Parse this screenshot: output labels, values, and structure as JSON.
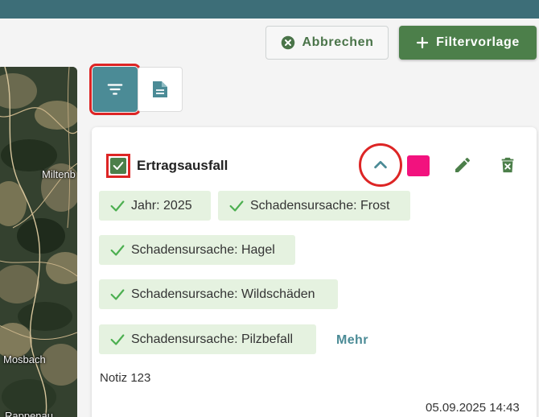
{
  "header": {
    "cancel_label": "Abbrechen",
    "new_template_label": "Filtervorlage",
    "accent": "#3d6e78"
  },
  "map": {
    "labels": [
      "Miltenb",
      "Mosbach",
      "Rappenau"
    ]
  },
  "view_toggle": {
    "icons": [
      "filter-icon",
      "document-icon"
    ],
    "active": "filter-icon"
  },
  "filter_card": {
    "title": "Ertragsausfall",
    "checked": true,
    "color": "#f2127e",
    "chips": [
      "Jahr: 2025",
      "Schadensursache: Frost",
      "Schadensursache: Hagel",
      "Schadensursache: Wildschäden",
      "Schadensursache: Pilzbefall"
    ],
    "more_label": "Mehr",
    "note": "Notiz 123",
    "timestamp": "05.09.2025 14:43"
  },
  "colors": {
    "primary_green": "#4c7f4a",
    "chip_bg": "#e5f2e0",
    "teal": "#4b8b96",
    "highlight_red": "#dd2525"
  }
}
